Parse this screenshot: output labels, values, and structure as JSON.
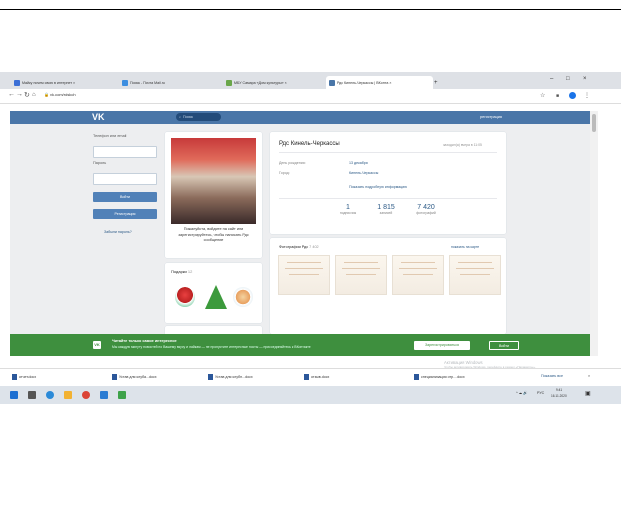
{
  "browser": {
    "tabs": [
      {
        "label": "Майку почем свою в интернет ×",
        "color": "#3b6fd6"
      },
      {
        "label": "Поиск - Почта Mail.ru",
        "color": "#3d8ee0"
      },
      {
        "label": "МБУ Самара «Дом культуры» ×",
        "color": "#6aa64a"
      },
      {
        "label": "Рдс Кинель-Черкассы | ВКонта ×",
        "color": "#4a76a8"
      }
    ],
    "new_tab": "+",
    "url": "vk.com/rdskch",
    "window_controls": [
      "–",
      "□",
      "×"
    ]
  },
  "vk": {
    "logo": "VK",
    "search_placeholder": "Поиск",
    "register": "регистрация",
    "login": {
      "phone_label": "Телефон или email",
      "password_label": "Пароль",
      "login_button": "Войти",
      "register_button": "Регистрация",
      "forgot": "Забыли пароль?"
    },
    "caption": "Пожалуйста, войдите на сайт или зарегистрируйтесь, чтобы написать Рдс сообщение",
    "gifts_title": "Подарки",
    "gifts_count": "12",
    "profile": {
      "name": "Рдс Кинель-Черкассы",
      "last_seen": "заходил(а) вчера в 11:05",
      "birthday_label": "День рождения:",
      "birthday_value": "13 декабря",
      "city_label": "Город:",
      "city_value": "Кинель-Черкассы",
      "more": "Показать подробную информацию",
      "stats": [
        {
          "num": "1",
          "label": "подписчик"
        },
        {
          "num": "1 815",
          "label": "записей"
        },
        {
          "num": "7 420",
          "label": "фотографий"
        }
      ]
    },
    "photos_title": "Фотографии Рдс",
    "photos_count": "7 402",
    "photos_link": "показать на карте"
  },
  "banner": {
    "icon": "VK",
    "title": "Читайте только самое интересное",
    "text": "Мы каждую минуту новостей по Вашему вкусу и лайкам — не пропустите интересные посты — присоединяйтесь к ВКонтакте",
    "btn_primary": "Зарегистрироваться",
    "btn_secondary": "Войти"
  },
  "downloads": {
    "items": [
      "отчет.docx",
      "Устав для клуба...docx",
      "Устав для клубн...docx",
      "отзыв.docx",
      "специализация отр....docx"
    ],
    "show_all": "Показать все",
    "close": "×"
  },
  "watermark": {
    "line1": "Активация Windows",
    "line2": "Чтобы активировать Windows, перейдите в раздел «Параметры»."
  },
  "taskbar": {
    "time": "9:41",
    "date": "16.11.2020",
    "lang": "РУС"
  }
}
